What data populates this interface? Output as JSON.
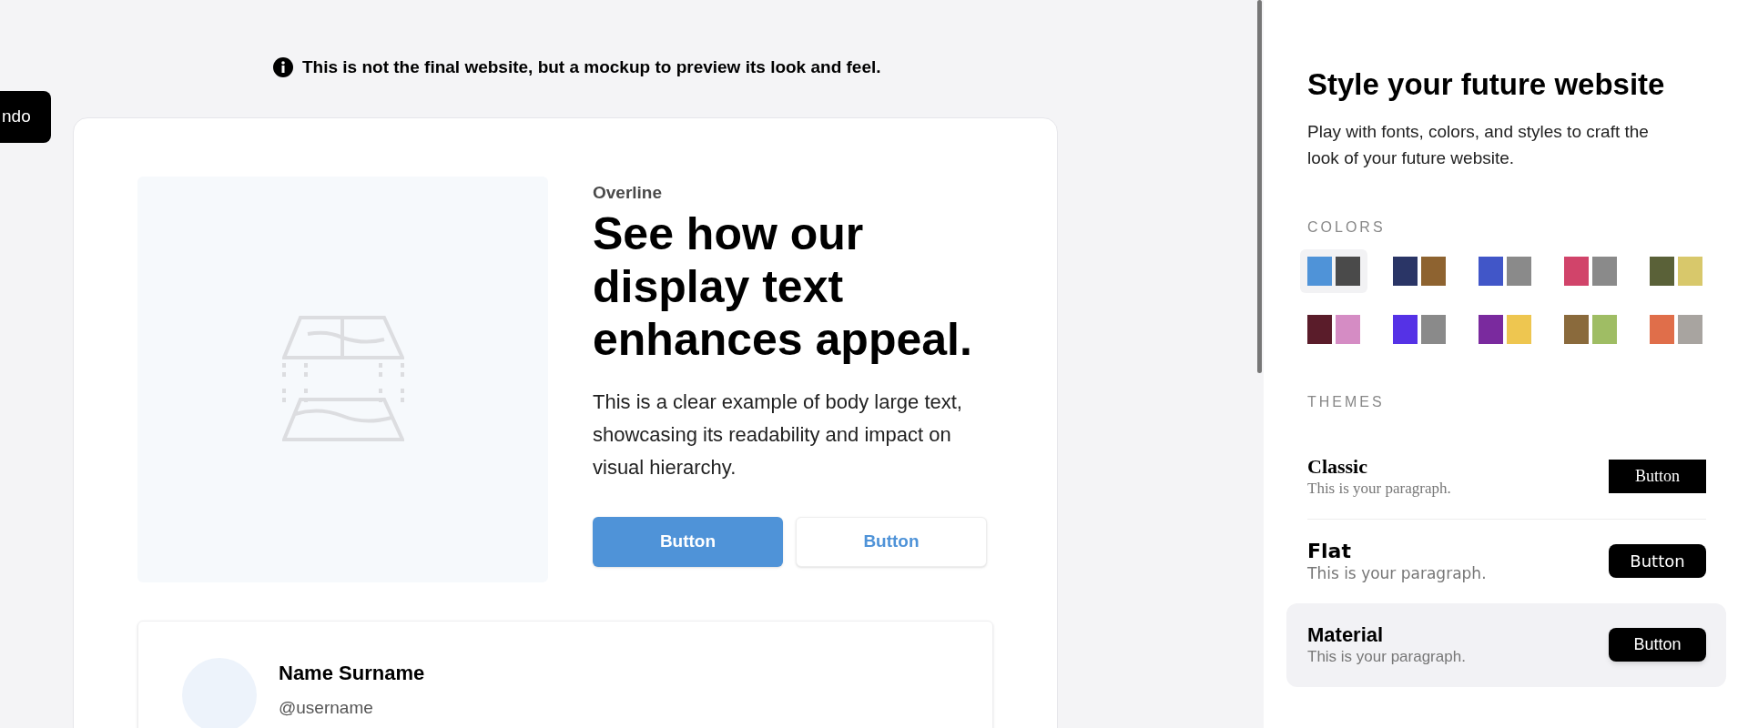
{
  "notice": {
    "text": "This is not the final website, but a mockup to preview its look and feel."
  },
  "undo_button": {
    "label": "ndo"
  },
  "preview": {
    "overline": "Overline",
    "heading": "See how our display text enhances appeal.",
    "body": "This is a clear example of body large text, showcasing its readability and impact on visual hierarchy.",
    "buttons": [
      {
        "label": "Button",
        "kind": "primary"
      },
      {
        "label": "Button",
        "kind": "secondary"
      }
    ],
    "profile": {
      "name": "Name Surname",
      "username": "@username"
    }
  },
  "panel": {
    "title": "Style your future website",
    "description": "Play with fonts, colors, and styles to craft the look of your future website.",
    "colors_label": "COLORS",
    "palettes": [
      {
        "selected": true,
        "swatches": [
          {
            "color": "#4f93d8"
          },
          {
            "color": "#4a4a4a"
          }
        ]
      },
      {
        "selected": false,
        "swatches": [
          {
            "color": "#2a3566"
          },
          {
            "color": "#8e6330"
          }
        ]
      },
      {
        "selected": false,
        "swatches": [
          {
            "color": "#4156c8"
          },
          {
            "color": "#8a8a8a"
          }
        ]
      },
      {
        "selected": false,
        "swatches": [
          {
            "color": "#d1446a"
          },
          {
            "color": "#8a8a8a"
          }
        ]
      },
      {
        "selected": false,
        "swatches": [
          {
            "color": "#5a6138"
          },
          {
            "color": "#d8c86b"
          }
        ]
      },
      {
        "selected": false,
        "swatches": [
          {
            "color": "#5a1c2a"
          },
          {
            "color": "#d58cc4"
          }
        ]
      },
      {
        "selected": false,
        "swatches": [
          {
            "color": "#5532e6"
          },
          {
            "color": "#8a8a8a"
          }
        ]
      },
      {
        "selected": false,
        "swatches": [
          {
            "color": "#7a2a9e"
          },
          {
            "color": "#eec650"
          }
        ]
      },
      {
        "selected": false,
        "swatches": [
          {
            "color": "#8a6a3c"
          },
          {
            "color": "#9fbd64"
          }
        ]
      },
      {
        "selected": false,
        "swatches": [
          {
            "color": "#e06e4a"
          },
          {
            "color": "#a8a4a0"
          }
        ]
      }
    ],
    "themes_label": "THEMES",
    "themes": [
      {
        "kind": "classic",
        "name": "Classic",
        "paragraph": "This is your paragraph.",
        "button": "Button",
        "selected": false
      },
      {
        "kind": "flat",
        "name": "Flat",
        "paragraph": "This is your paragraph.",
        "button": "Button",
        "selected": false
      },
      {
        "kind": "material",
        "name": "Material",
        "paragraph": "This is your paragraph.",
        "button": "Button",
        "selected": true
      }
    ]
  }
}
